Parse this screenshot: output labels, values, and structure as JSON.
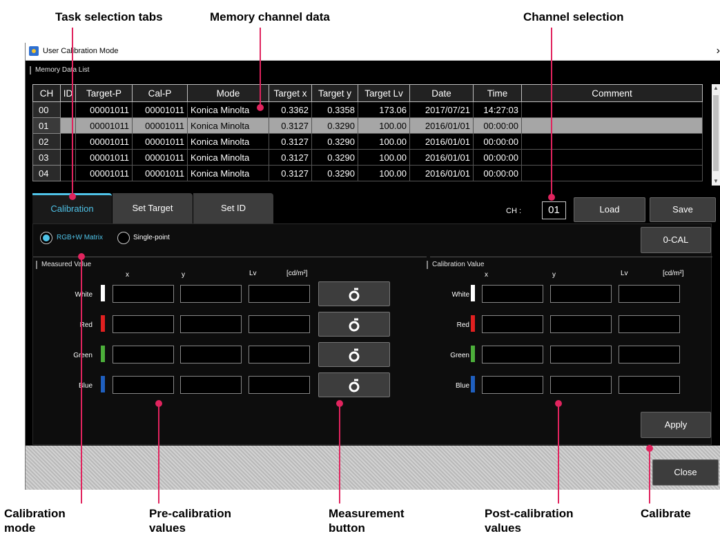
{
  "callouts": {
    "task_tabs": "Task selection tabs",
    "memory_data": "Memory channel data",
    "channel_selection": "Channel selection",
    "calibration_mode_1": "Calibration",
    "calibration_mode_2": "mode",
    "pre_cal_1": "Pre-calibration",
    "pre_cal_2": "values",
    "measurement_1": "Measurement",
    "measurement_2": "button",
    "post_cal_1": "Post-calibration",
    "post_cal_2": "values",
    "calibrate": "Calibrate"
  },
  "window": {
    "title": "User Calibration Mode",
    "close_glyph": "›"
  },
  "memory_list": {
    "label": "Memory Data List",
    "columns": [
      "CH",
      "ID",
      "Target-P",
      "Cal-P",
      "Mode",
      "Target x",
      "Target y",
      "Target Lv",
      "Date",
      "Time",
      "Comment"
    ],
    "rows": [
      {
        "ch": "00",
        "id": "",
        "target_p": "00001011",
        "cal_p": "00001011",
        "mode": "Konica Minolta",
        "tx": "0.3362",
        "ty": "0.3358",
        "tlv": "173.06",
        "date": "2017/07/21",
        "time": "14:27:03",
        "comment": ""
      },
      {
        "ch": "01",
        "id": "",
        "target_p": "00001011",
        "cal_p": "00001011",
        "mode": "Konica Minolta",
        "tx": "0.3127",
        "ty": "0.3290",
        "tlv": "100.00",
        "date": "2016/01/01",
        "time": "00:00:00",
        "comment": ""
      },
      {
        "ch": "02",
        "id": "",
        "target_p": "00001011",
        "cal_p": "00001011",
        "mode": "Konica Minolta",
        "tx": "0.3127",
        "ty": "0.3290",
        "tlv": "100.00",
        "date": "2016/01/01",
        "time": "00:00:00",
        "comment": ""
      },
      {
        "ch": "03",
        "id": "",
        "target_p": "00001011",
        "cal_p": "00001011",
        "mode": "Konica Minolta",
        "tx": "0.3127",
        "ty": "0.3290",
        "tlv": "100.00",
        "date": "2016/01/01",
        "time": "00:00:00",
        "comment": ""
      },
      {
        "ch": "04",
        "id": "",
        "target_p": "00001011",
        "cal_p": "00001011",
        "mode": "Konica Minolta",
        "tx": "0.3127",
        "ty": "0.3290",
        "tlv": "100.00",
        "date": "2016/01/01",
        "time": "00:00:00",
        "comment": ""
      }
    ],
    "selected_row": 1
  },
  "tabs": [
    {
      "label": "Calibration",
      "active": true
    },
    {
      "label": "Set Target",
      "active": false
    },
    {
      "label": "Set ID",
      "active": false
    }
  ],
  "channel": {
    "label": "CH :",
    "value": "01",
    "load_label": "Load",
    "save_label": "Save"
  },
  "mode": {
    "option_matrix": "RGB+W Matrix",
    "option_single": "Single-point",
    "selected": "matrix",
    "zero_cal_label": "0-CAL"
  },
  "measured": {
    "label": "Measured Value",
    "col_x": "x",
    "col_y": "y",
    "col_lv": "Lv",
    "unit": "[cd/m²]"
  },
  "calibration_value": {
    "label": "Calibration Value",
    "col_x": "x",
    "col_y": "y",
    "col_lv": "Lv",
    "unit": "[cd/m²]"
  },
  "colors": [
    {
      "name": "White",
      "swatch": "#ffffff"
    },
    {
      "name": "Red",
      "swatch": "#e02020"
    },
    {
      "name": "Green",
      "swatch": "#4caf3a"
    },
    {
      "name": "Blue",
      "swatch": "#1f5fbf"
    }
  ],
  "buttons": {
    "apply": "Apply",
    "close": "Close"
  },
  "accent_color": "#4fc3e8",
  "callout_color": "#e0245e"
}
